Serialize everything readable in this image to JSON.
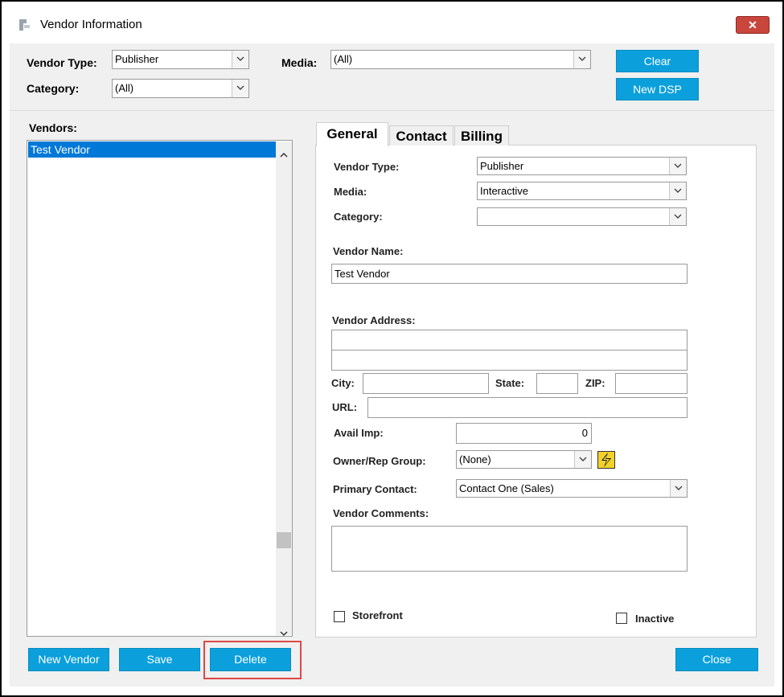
{
  "window": {
    "title": "Vendor Information",
    "close_glyph": "✕"
  },
  "filters": {
    "vendor_type_label": "Vendor Type:",
    "vendor_type_value": "Publisher",
    "category_label": "Category:",
    "category_value": "(All)",
    "media_label": "Media:",
    "media_value": "(All)",
    "clear_label": "Clear",
    "new_dsp_label": "New DSP"
  },
  "vendors": {
    "label": "Vendors:",
    "items": [
      "Test Vendor"
    ],
    "selected_index": 0
  },
  "tabs": [
    {
      "label": "General",
      "active": true
    },
    {
      "label": "Contact",
      "active": false
    },
    {
      "label": "Billing",
      "active": false
    }
  ],
  "general": {
    "vendor_type_label": "Vendor Type:",
    "vendor_type_value": "Publisher",
    "media_label": "Media:",
    "media_value": "Interactive",
    "category_label": "Category:",
    "category_value": "",
    "vendor_name_label": "Vendor Name:",
    "vendor_name_value": "Test Vendor",
    "vendor_address_label": "Vendor Address:",
    "address_line1": "",
    "address_line2": "",
    "city_label": "City:",
    "city_value": "",
    "state_label": "State:",
    "state_value": "",
    "zip_label": "ZIP:",
    "zip_value": "",
    "url_label": "URL:",
    "url_value": "",
    "avail_imp_label": "Avail Imp:",
    "avail_imp_value": "0",
    "owner_rep_label": "Owner/Rep Group:",
    "owner_rep_value": "(None)",
    "primary_contact_label": "Primary Contact:",
    "primary_contact_value": "Contact One (Sales)",
    "vendor_comments_label": "Vendor Comments:",
    "vendor_comments_value": "",
    "storefront_label": "Storefront",
    "storefront_checked": false,
    "inactive_label": "Inactive",
    "inactive_checked": false
  },
  "actions": {
    "new_vendor_label": "New Vendor",
    "save_label": "Save",
    "delete_label": "Delete",
    "close_label": "Close"
  },
  "colors": {
    "accent": "#0ba0db",
    "selection": "#0078d7",
    "highlight": "#e04646",
    "close_button": "#c9463d"
  }
}
